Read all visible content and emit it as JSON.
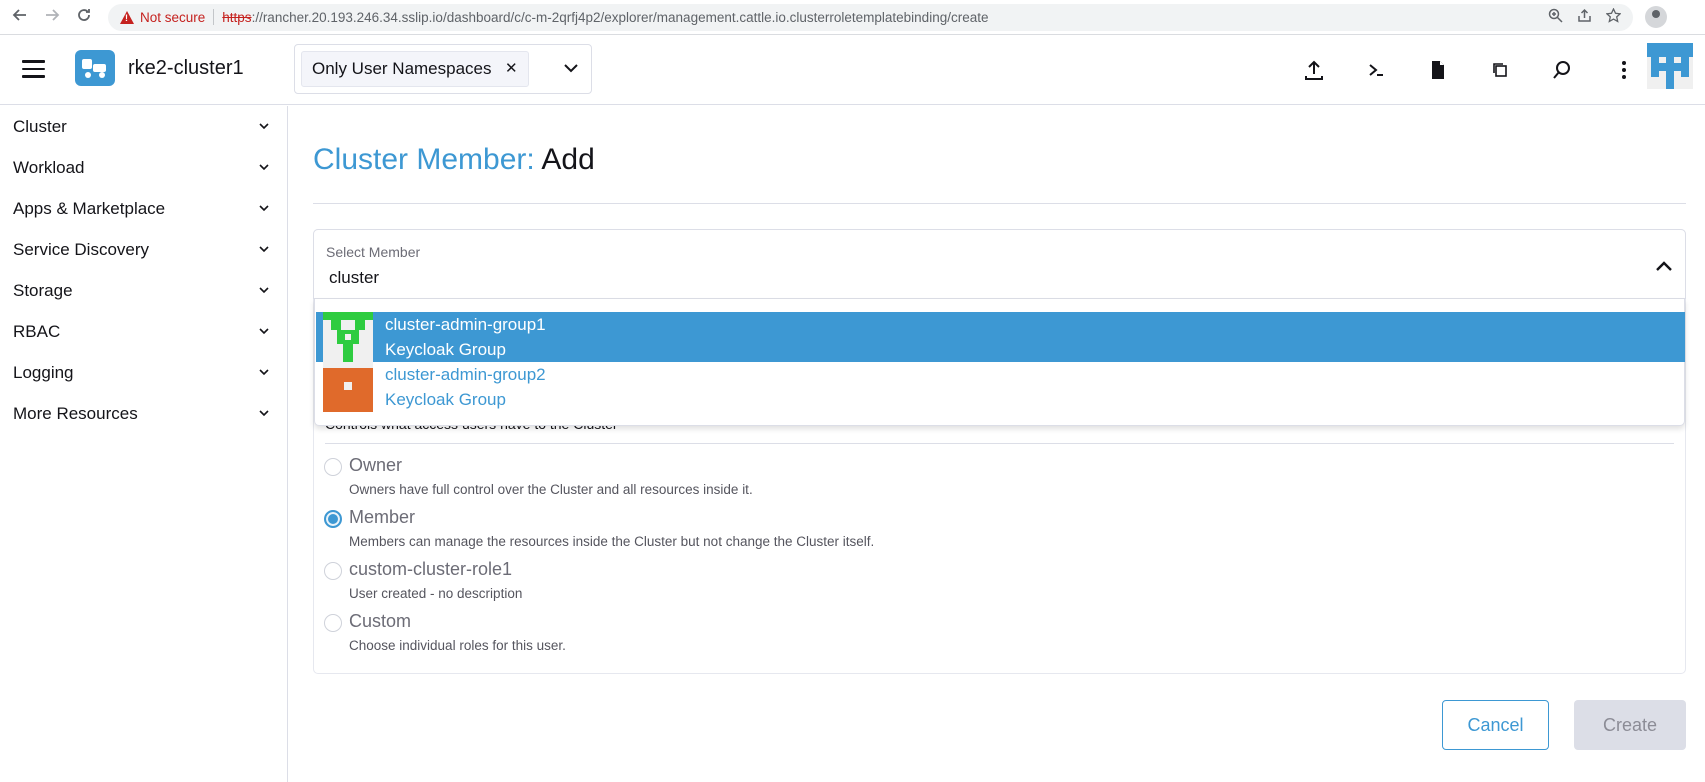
{
  "browser": {
    "security_label": "Not secure",
    "url_scheme": "https",
    "url_rest": "://rancher.20.193.246.34.sslip.io/dashboard/c/c-m-2qrfj4p2/explorer/management.cattle.io.clusterroletemplatebinding/create"
  },
  "header": {
    "cluster_name": "rke2-cluster1",
    "namespace_filter": "Only User Namespaces"
  },
  "sidebar": {
    "items": [
      {
        "label": "Cluster"
      },
      {
        "label": "Workload"
      },
      {
        "label": "Apps & Marketplace"
      },
      {
        "label": "Service Discovery"
      },
      {
        "label": "Storage"
      },
      {
        "label": "RBAC"
      },
      {
        "label": "Logging"
      },
      {
        "label": "More Resources"
      }
    ]
  },
  "page": {
    "title_prefix": "Cluster Member:",
    "title_action": "Add"
  },
  "member_select": {
    "label": "Select Member",
    "value": "cluster",
    "options": [
      {
        "name": "cluster-admin-group1",
        "type": "Keycloak Group",
        "selected": true,
        "avatar_color": "#2ecc40"
      },
      {
        "name": "cluster-admin-group2",
        "type": "Keycloak Group",
        "selected": false,
        "avatar_color": "#e06a2b"
      }
    ]
  },
  "permissions": {
    "description": "Controls what access users have to the Cluster",
    "options": [
      {
        "label": "Owner",
        "description": "Owners have full control over the Cluster and all resources inside it.",
        "checked": false
      },
      {
        "label": "Member",
        "description": "Members can manage the resources inside the Cluster but not change the Cluster itself.",
        "checked": true
      },
      {
        "label": "custom-cluster-role1",
        "description": "User created - no description",
        "checked": false
      },
      {
        "label": "Custom",
        "description": "Choose individual roles for this user.",
        "checked": false
      }
    ]
  },
  "actions": {
    "cancel": "Cancel",
    "create": "Create"
  },
  "colors": {
    "accent": "#3d98d3",
    "disabled": "#dcdee7"
  }
}
